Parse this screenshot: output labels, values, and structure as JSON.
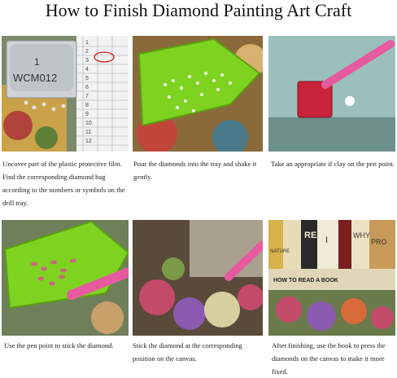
{
  "title": "How to Finish Diamond Painting Art Craft",
  "steps": [
    {
      "caption": "Uncover part of the plastic protective film. Find the corresponding diamond bag according to the numbers or symbols on the drill tray."
    },
    {
      "caption": "Pour the diamonds into the tray and shake it gently."
    },
    {
      "caption": "Take an appropriate if clay on the pen point."
    },
    {
      "caption": "Use the pen point to stick the diamond."
    },
    {
      "caption": "Stick the diamond at the corresponding position on the canvas."
    },
    {
      "caption": "After finishing, use the book to press the diamonds on the canvas to make it more fixed."
    }
  ],
  "photo1": {
    "bag_number": "1",
    "bag_code": "WCM012",
    "chart_rows": [
      "1",
      "2",
      "3",
      "4",
      "5",
      "6",
      "7",
      "8",
      "9",
      "10",
      "11",
      "12"
    ]
  },
  "photo6": {
    "spines": [
      "REA",
      "I",
      "WHY",
      "PRO",
      "NATURE"
    ],
    "book_title": "HOW TO READ A BOOK"
  },
  "colors": {
    "tray_green": "#7ed321",
    "pen_pink": "#e85aa0",
    "clay_red": "#c8233a"
  }
}
